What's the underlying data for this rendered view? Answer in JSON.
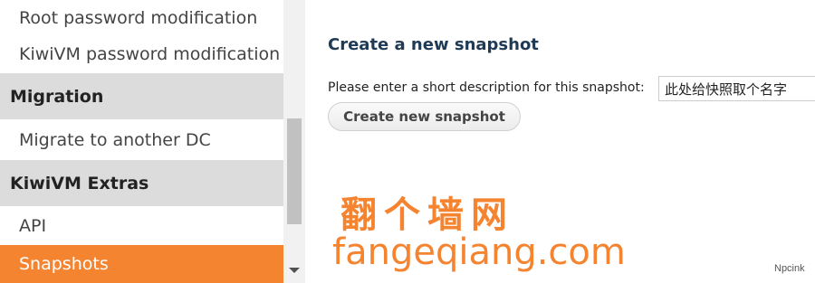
{
  "sidebar": {
    "items": [
      {
        "label": "Root password modification",
        "type": "item"
      },
      {
        "label": "KiwiVM password modification",
        "type": "item"
      },
      {
        "label": "Migration",
        "type": "header"
      },
      {
        "label": "Migrate to another DC",
        "type": "item"
      },
      {
        "label": "KiwiVM Extras",
        "type": "header"
      },
      {
        "label": "API",
        "type": "item"
      },
      {
        "label": "Snapshots",
        "type": "item",
        "active": true
      }
    ]
  },
  "main": {
    "title": "Create a new snapshot",
    "description_label": "Please enter a short description for this snapshot:",
    "description_value": "此处给快照取个名字",
    "create_button_label": "Create new snapshot"
  },
  "watermark": {
    "chinese": "翻个墙网",
    "domain": "fangeqiang.com",
    "small": "Npcink"
  },
  "colors": {
    "accent": "#f58431",
    "header_bg": "#dcdcdc",
    "title": "#1f3a55"
  }
}
